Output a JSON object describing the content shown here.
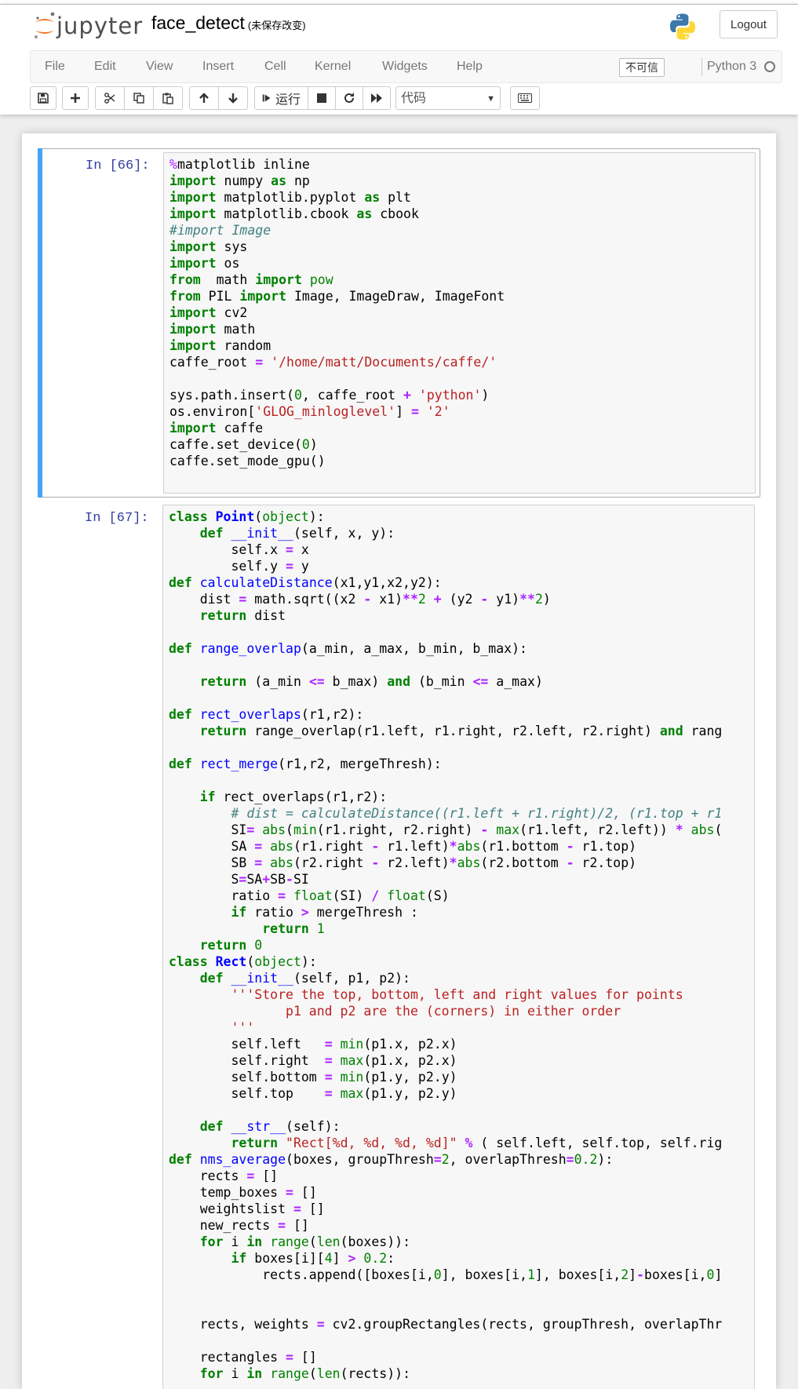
{
  "header": {
    "logo_text": "jupyter",
    "notebook_name": "face_detect",
    "save_status": "(未保存改变)",
    "logout_label": "Logout"
  },
  "menu": {
    "items": [
      "File",
      "Edit",
      "View",
      "Insert",
      "Cell",
      "Kernel",
      "Widgets",
      "Help"
    ],
    "trust_label": "不可信",
    "kernel_name": "Python 3"
  },
  "toolbar": {
    "run_label": "运行",
    "cell_type": "代码",
    "icons": [
      "save-icon",
      "plus-icon",
      "cut-icon",
      "copy-icon",
      "paste-icon",
      "arrow-up-icon",
      "arrow-down-icon",
      "step-forward-icon",
      "stop-icon",
      "refresh-icon",
      "fast-forward-icon",
      "keyboard-icon"
    ]
  },
  "cells": [
    {
      "prompt": "In [66]:",
      "code": "%matplotlib inline\nimport numpy as np\nimport matplotlib.pyplot as plt\nimport matplotlib.cbook as cbook\n#import Image\nimport sys\nimport os\nfrom  math import pow\nfrom PIL import Image, ImageDraw, ImageFont\nimport cv2\nimport math\nimport random\ncaffe_root = '/home/matt/Documents/caffe/'\n\nsys.path.insert(0, caffe_root + 'python')\nos.environ['GLOG_minloglevel'] = '2'\nimport caffe\ncaffe.set_device(0)\ncaffe.set_mode_gpu()\n"
    },
    {
      "prompt": "In [67]:",
      "code": "class Point(object):\n    def __init__(self, x, y):\n        self.x = x\n        self.y = y\ndef calculateDistance(x1,y1,x2,y2):\n    dist = math.sqrt((x2 - x1)**2 + (y2 - y1)**2)\n    return dist\n\ndef range_overlap(a_min, a_max, b_min, b_max):\n\n    return (a_min <= b_max) and (b_min <= a_max)\n\ndef rect_overlaps(r1,r2):\n    return range_overlap(r1.left, r1.right, r2.left, r2.right) and rang\n\ndef rect_merge(r1,r2, mergeThresh):\n\n    if rect_overlaps(r1,r2):\n        # dist = calculateDistance((r1.left + r1.right)/2, (r1.top + r1\n        SI= abs(min(r1.right, r2.right) - max(r1.left, r2.left)) * abs(\n        SA = abs(r1.right - r1.left)*abs(r1.bottom - r1.top)\n        SB = abs(r2.right - r2.left)*abs(r2.bottom - r2.top)\n        S=SA+SB-SI\n        ratio = float(SI) / float(S)\n        if ratio > mergeThresh :\n            return 1\n    return 0\nclass Rect(object):\n    def __init__(self, p1, p2):\n        '''Store the top, bottom, left and right values for points\n               p1 and p2 are the (corners) in either order\n        '''\n        self.left   = min(p1.x, p2.x)\n        self.right  = max(p1.x, p2.x)\n        self.bottom = min(p1.y, p2.y)\n        self.top    = max(p1.y, p2.y)\n\n    def __str__(self):\n        return \"Rect[%d, %d, %d, %d]\" % ( self.left, self.top, self.rig\ndef nms_average(boxes, groupThresh=2, overlapThresh=0.2):\n    rects = []\n    temp_boxes = []\n    weightslist = []\n    new_rects = []\n    for i in range(len(boxes)):\n        if boxes[i][4] > 0.2:\n            rects.append([boxes[i,0], boxes[i,1], boxes[i,2]-boxes[i,0]\n\n\n    rects, weights = cv2.groupRectangles(rects, groupThresh, overlapThr\n\n    rectangles = []\n    for i in range(len(rects)):"
    }
  ],
  "colors": {
    "selected_bar": "#42a5f5",
    "prompt": "#303f9f",
    "keyword": "#008000",
    "operator": "#aa22ff",
    "string": "#ba2121",
    "comment": "#408080",
    "function": "#0000ff"
  }
}
